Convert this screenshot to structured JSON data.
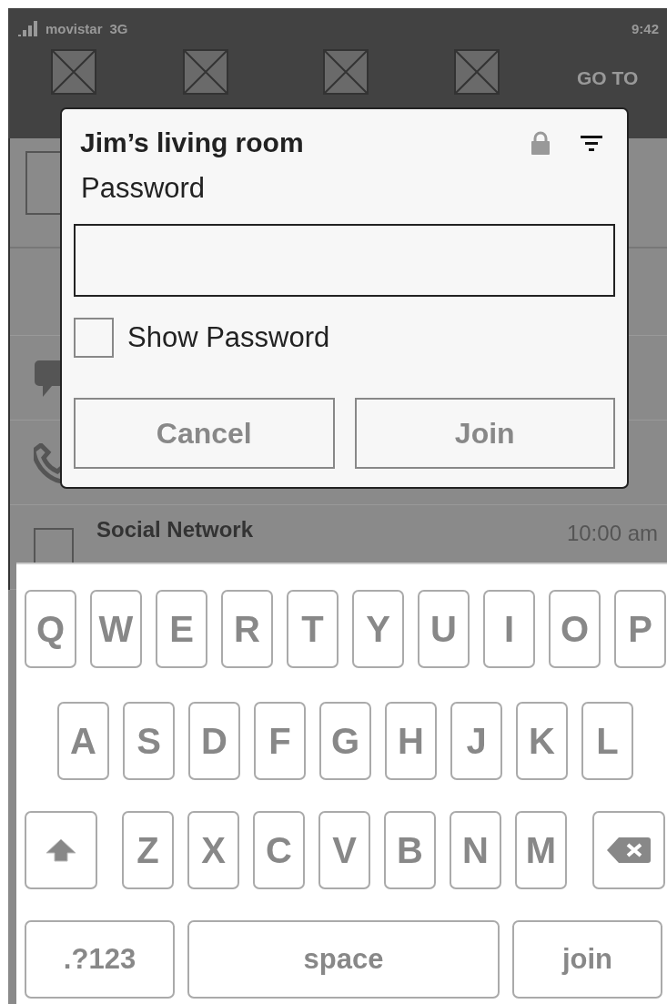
{
  "status_bar": {
    "carrier": "movistar",
    "network": "3G",
    "time": "9:42"
  },
  "quick_settings": {
    "settings_link": "GO TO"
  },
  "notifications": [
    {
      "kind": "message"
    },
    {
      "kind": "call"
    },
    {
      "kind": "app",
      "title": "Social Network",
      "time": "10:00 am"
    }
  ],
  "dialog": {
    "title": "Jim’s living room",
    "password_label": "Password",
    "show_password": {
      "label": "Show Password",
      "checked": false
    },
    "buttons": [
      "Cancel",
      "Join"
    ]
  },
  "keyboard": {
    "rows": [
      {
        "keys": [
          {
            "kind": "char",
            "label": "Q"
          },
          {
            "kind": "char",
            "label": "W"
          },
          {
            "kind": "char",
            "label": "E"
          },
          {
            "kind": "char",
            "label": "R"
          },
          {
            "kind": "char",
            "label": "T"
          },
          {
            "kind": "char",
            "label": "Y"
          },
          {
            "kind": "char",
            "label": "U"
          },
          {
            "kind": "char",
            "label": "I"
          },
          {
            "kind": "char",
            "label": "O"
          },
          {
            "kind": "char",
            "label": "P"
          }
        ]
      },
      {
        "keys": [
          {
            "kind": "char",
            "label": "A"
          },
          {
            "kind": "char",
            "label": "S"
          },
          {
            "kind": "char",
            "label": "D"
          },
          {
            "kind": "char",
            "label": "F"
          },
          {
            "kind": "char",
            "label": "G"
          },
          {
            "kind": "char",
            "label": "H"
          },
          {
            "kind": "char",
            "label": "J"
          },
          {
            "kind": "char",
            "label": "K"
          },
          {
            "kind": "char",
            "label": "L"
          }
        ]
      },
      {
        "keys": [
          {
            "kind": "shift"
          },
          {
            "kind": "char",
            "label": "Z"
          },
          {
            "kind": "char",
            "label": "X"
          },
          {
            "kind": "char",
            "label": "C"
          },
          {
            "kind": "char",
            "label": "V"
          },
          {
            "kind": "char",
            "label": "B"
          },
          {
            "kind": "char",
            "label": "N"
          },
          {
            "kind": "char",
            "label": "M"
          },
          {
            "kind": "backspace"
          }
        ]
      },
      {
        "keys": [
          {
            "kind": "symbols",
            "label": ".?123"
          },
          {
            "kind": "space",
            "label": "space"
          },
          {
            "kind": "action",
            "label": "join"
          }
        ]
      }
    ]
  }
}
